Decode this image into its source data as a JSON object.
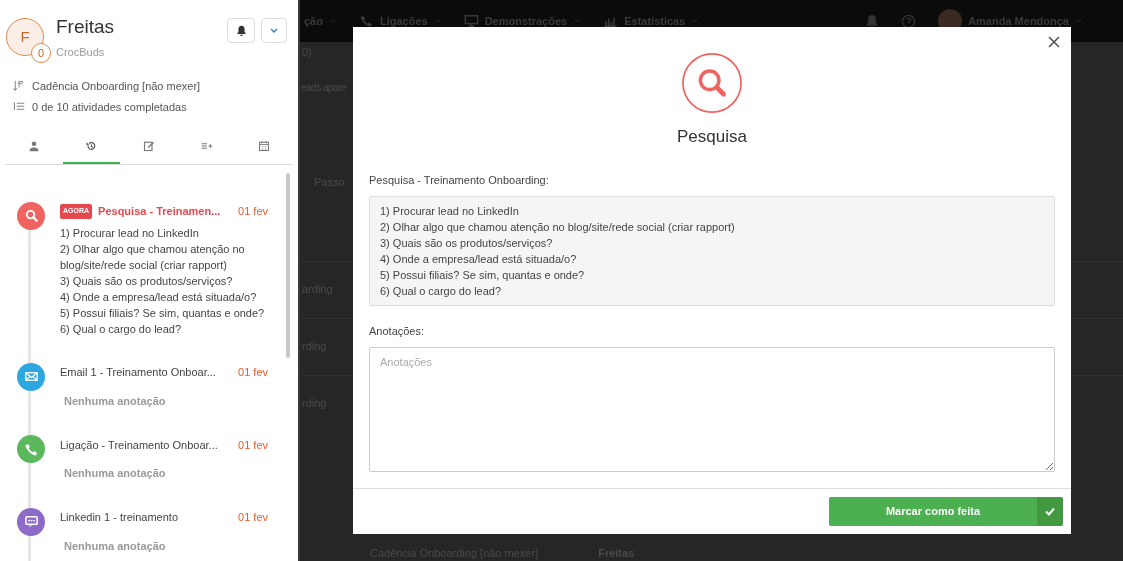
{
  "background": {
    "nav": [
      {
        "label": "ção",
        "kind": "none"
      },
      {
        "label": "Ligações",
        "kind": "phone"
      },
      {
        "label": "Demonstrações",
        "kind": "monitor"
      },
      {
        "label": "Estatísticas",
        "kind": "chart"
      }
    ],
    "user": "Amanda Mendonça",
    "counter": "0)",
    "hint": "eads apare",
    "filter": "Passo",
    "rows": [
      "arding",
      "rding",
      "rding"
    ],
    "bottom_cadence": "Cadência Onboarding [não mexer]",
    "bottom_name": "Freitas"
  },
  "lead": {
    "initial": "F",
    "badge": "0",
    "name": "Freitas",
    "company": "CrocBuds",
    "cadence": "Cadência Onboarding [não mexer]",
    "progress": "0 de 10 atividades completadas"
  },
  "tabs": [
    {
      "kind": "person",
      "selected": false
    },
    {
      "kind": "history",
      "selected": true
    },
    {
      "kind": "edit",
      "selected": false
    },
    {
      "kind": "list-add",
      "selected": false
    },
    {
      "kind": "calendar",
      "selected": false
    }
  ],
  "activities": [
    {
      "kind": "search",
      "color": "#ef6461",
      "tag": "AGORA",
      "title": "Pesquisa - Treinamen...",
      "date": "01 fev",
      "lines": [
        "1) Procurar lead no LinkedIn",
        "2) Olhar algo que chamou atenção no blog/site/rede social (criar rapport)",
        "3) Quais são os produtos/serviços?",
        "4) Onde a empresa/lead está situada/o?",
        "5) Possui filiais? Se sim, quantas e onde?",
        "6) Qual o cargo do lead?"
      ]
    },
    {
      "kind": "email",
      "color": "#2ea7e0",
      "title": "Email 1 - Treinamento Onboar...",
      "date": "01 fev",
      "note": "Nenhuma anotação"
    },
    {
      "kind": "call",
      "color": "#5cb85c",
      "title": "Ligação - Treinamento Onboar...",
      "date": "01 fev",
      "note": "Nenhuma anotação"
    },
    {
      "kind": "linkedin",
      "color": "#8e6bc8",
      "title": "Linkedin 1 - treinamento",
      "date": "01 fev",
      "note": "Nenhuma anotação"
    }
  ],
  "modal": {
    "title": "Pesquisa",
    "section_label": "Pesquisa - Treinamento Onboarding:",
    "lines": [
      "1) Procurar lead no LinkedIn",
      "2) Olhar algo que chamou atenção no blog/site/rede social (criar rapport)",
      "3) Quais são os produtos/serviços?",
      "4) Onde a empresa/lead está situada/o?",
      "5) Possui filiais? Se sim, quantas e onde?",
      "6) Qual o cargo do lead?"
    ],
    "notes_label": "Anotações:",
    "notes": {
      "placeholder": "Anotações"
    },
    "button": "Marcar como feita"
  }
}
